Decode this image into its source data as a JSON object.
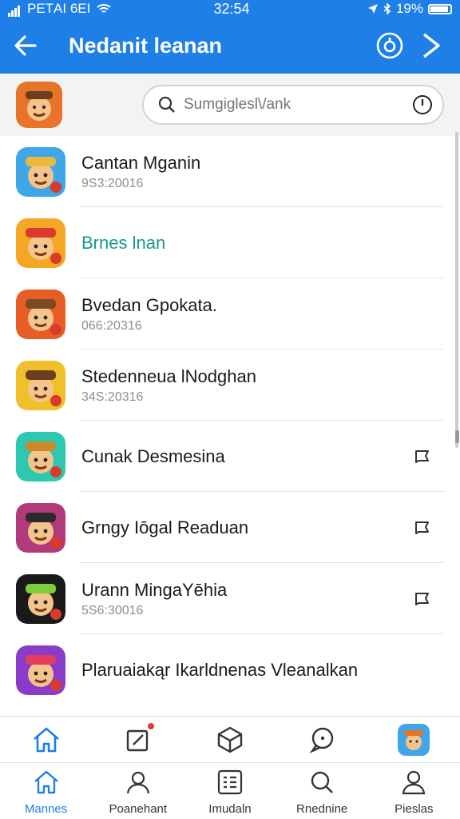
{
  "status_bar": {
    "carrier": "PEТAI 6ЕI",
    "time": "32:54",
    "battery": "19%"
  },
  "header": {
    "title": "Nedanit leanan"
  },
  "search": {
    "placeholder": "Sumgiglesl\\/ank"
  },
  "conversations": [
    {
      "name": "Cantan Mganin",
      "sub": "9S3:20016",
      "avatar_bg": "#3fa6e8",
      "hat": "#e8b93a",
      "action": false,
      "highlight": false
    },
    {
      "name": "Brnes lnan",
      "sub": "",
      "avatar_bg": "#f5a623",
      "hat": "#d93a2b",
      "action": false,
      "highlight": true
    },
    {
      "name": "Bvedan Gpokata.",
      "sub": "066:20316",
      "avatar_bg": "#e85d26",
      "hat": "#7a4a22",
      "action": false,
      "highlight": false
    },
    {
      "name": "Stedenneua lNodghan",
      "sub": "34S:20316",
      "avatar_bg": "#f0c02c",
      "hat": "#6b3e1e",
      "action": false,
      "highlight": false
    },
    {
      "name": "Cunak Desmesina",
      "sub": "",
      "avatar_bg": "#2cc9b0",
      "hat": "#c98b2a",
      "action": true,
      "highlight": false
    },
    {
      "name": "Grngy Iōgal Readuan",
      "sub": "",
      "avatar_bg": "#b03a7a",
      "hat": "#2a2a2a",
      "action": true,
      "highlight": false
    },
    {
      "name": "Urann MingaYēhia",
      "sub": "5S6:30016",
      "avatar_bg": "#1a1a1a",
      "hat": "#7ccf3a",
      "action": true,
      "highlight": false
    },
    {
      "name": "Plaruaiakąr Ikarldnenas Vleanalkan",
      "sub": "",
      "avatar_bg": "#8a3cc9",
      "hat": "#e23d5c",
      "action": false,
      "highlight": false
    }
  ],
  "tabs": [
    {
      "label": "Mannes",
      "icon": "home-icon",
      "active": true
    },
    {
      "label": "Poanehant",
      "icon": "people-icon",
      "active": false
    },
    {
      "label": "Imudaln",
      "icon": "grid-list-icon",
      "active": false
    },
    {
      "label": "Rnednine",
      "icon": "search-icon",
      "active": false
    },
    {
      "label": "Pieslas",
      "icon": "profile-icon",
      "active": false
    }
  ],
  "colors": {
    "accent": "#1e7fe6",
    "highlight_text": "#179a86"
  }
}
